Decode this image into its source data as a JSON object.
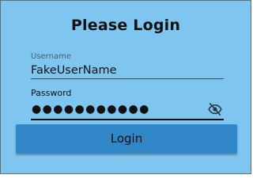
{
  "login_form": {
    "title": "Please Login",
    "username": {
      "label": "Username",
      "value": "FakeUserName"
    },
    "password": {
      "label": "Password",
      "value": "●●●●●●●●●●●",
      "toggle_icon": "eye-off-icon"
    },
    "submit_label": "Login"
  },
  "colors": {
    "background": "#7ec5f0",
    "button": "#3186c8",
    "border": "#6c6c6c"
  }
}
